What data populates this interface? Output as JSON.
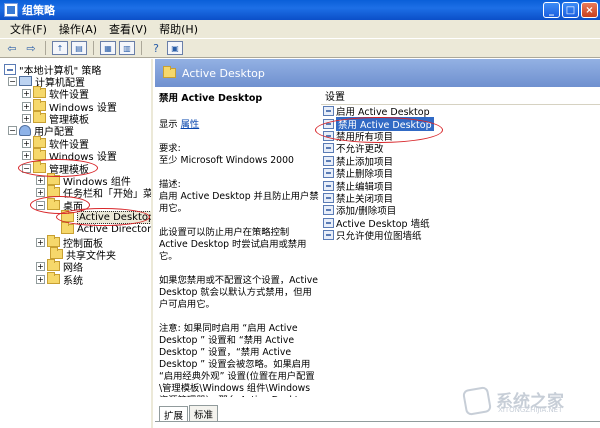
{
  "window": {
    "title": "组策略",
    "min_label": "_",
    "max_label": "□",
    "close_label": "×"
  },
  "menu": [
    "文件(F)",
    "操作(A)",
    "查看(V)",
    "帮助(H)"
  ],
  "tree": {
    "root": "\"本地计算机\" 策略",
    "computer_config": "计算机配置",
    "cc_software": "软件设置",
    "cc_windows": "Windows 设置",
    "cc_admin": "管理模板",
    "user_config": "用户配置",
    "uc_software": "软件设置",
    "uc_windows": "Windows 设置",
    "uc_admin": "管理模板",
    "windows_components": "Windows 组件",
    "taskbar": "任务栏和「开始」菜",
    "desktop": "桌面",
    "active_desktop": "Active Desktop",
    "active_directory": "Active Director",
    "control_panel": "控制面板",
    "shared_folders": "共享文件夹",
    "network": "网络",
    "system": "系统"
  },
  "right": {
    "header": "Active Desktop",
    "desc_title": "禁用 Active Desktop",
    "show_label": "显示",
    "properties_link": "属性",
    "req_label": "要求:",
    "req_value": "至少 Microsoft Windows 2000",
    "desc_label": "描述:",
    "desc_p1": "启用 Active Desktop 并且防止用户禁用它。",
    "desc_p2": "此设置可以防止用户在策略控制 Active Desktop 时尝试启用或禁用它。",
    "desc_p3": "如果您禁用或不配置这个设置，Active Desktop 就会以默认方式禁用，但用户可启用它。",
    "desc_p4": "注意: 如果同时启用 “启用 Active Desktop ” 设置和 “禁用 Active Desktop ” 设置，“禁用 Active Desktop ” 设置会被忽略。如果启用 “启用经典外观” 设置(位置在用户配置\\管理模板\\Windows 组件\\Windows 资源管理器)，那么 Active Desktop 就会被禁用，并且这两个设置都会被忽略。",
    "list_header": "设置",
    "items": [
      "启用 Active Desktop",
      "禁用 Active Desktop",
      "禁用所有项目",
      "不允许更改",
      "禁止添加项目",
      "禁止删除项目",
      "禁止编辑项目",
      "禁止关闭项目",
      "添加/删除项目",
      "Active Desktop 墙纸",
      "只允许使用位图墙纸"
    ],
    "selected_index": 1,
    "tabs": [
      "扩展",
      "标准"
    ]
  },
  "watermark": {
    "text": "系统之家",
    "url": "XITONGZHIJIA.NET"
  }
}
